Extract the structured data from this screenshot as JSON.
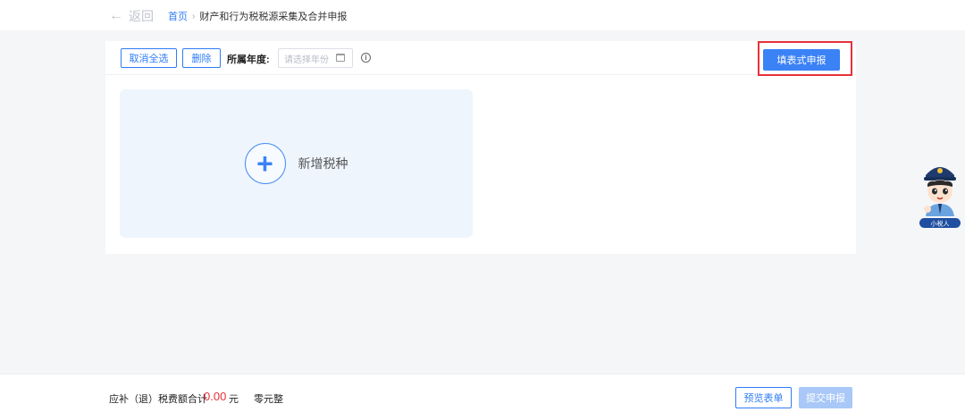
{
  "header": {
    "back_label": "返回",
    "breadcrumb_home": "首页",
    "breadcrumb_separator": "›",
    "breadcrumb_current": "财产和行为税税源采集及合并申报"
  },
  "toolbar": {
    "cancel_select_all": "取消全选",
    "delete": "删除",
    "year_label": "所属年度:",
    "year_placeholder": "请选择年份",
    "info_symbol": "i",
    "form_declare": "填表式申报"
  },
  "main": {
    "add_tax_type": "新增税种",
    "add_symbol": "+"
  },
  "mascot": {
    "badge": "小税人"
  },
  "footer": {
    "sum_label": "应补（退）税费额合计",
    "sum_value": "0.00",
    "sum_unit": "元",
    "sum_words": "零元整",
    "preview": "预览表单",
    "submit": "提交申报"
  },
  "colors": {
    "accent": "#3b82f6",
    "highlight": "#e8313a",
    "card_bg": "#eef5fd",
    "disabled": "#a9c8f7"
  },
  "icons": [
    "back-arrow-icon",
    "calendar-icon",
    "info-icon",
    "plus-icon"
  ]
}
